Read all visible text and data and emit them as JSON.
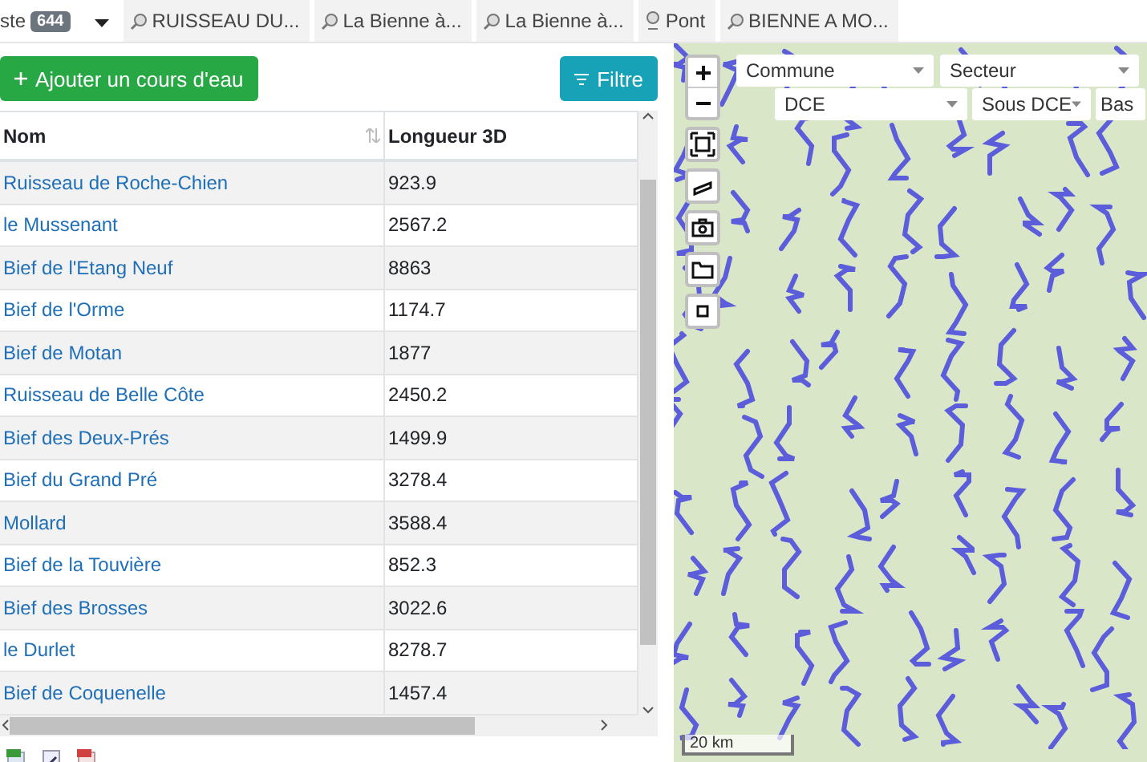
{
  "tabs": [
    {
      "label": "ste",
      "badge": "644",
      "kind": "list",
      "selected": true
    },
    {
      "label": "RUISSEAU DU...",
      "kind": "search",
      "selected": false
    },
    {
      "label": "La Bienne à...",
      "kind": "search",
      "selected": false
    },
    {
      "label": "La Bienne à...",
      "kind": "search",
      "selected": false
    },
    {
      "label": "Pont",
      "kind": "point",
      "selected": false
    },
    {
      "label": "BIENNE A MO...",
      "kind": "search",
      "selected": false
    }
  ],
  "toolbar": {
    "add_button": "Ajouter un cours d'eau",
    "filter_button": "Filtre"
  },
  "table": {
    "columns": [
      {
        "label": "Nom",
        "sortable": true
      },
      {
        "label": "Longueur 3D",
        "sortable": false
      }
    ],
    "rows": [
      {
        "name": "Ruisseau de Roche-Chien",
        "length": "923.9"
      },
      {
        "name": "le Mussenant",
        "length": "2567.2"
      },
      {
        "name": "Bief de l'Etang Neuf",
        "length": "8863"
      },
      {
        "name": "Bief de l'Orme",
        "length": "1174.7"
      },
      {
        "name": "Bief de Motan",
        "length": "1877"
      },
      {
        "name": "Ruisseau de Belle Côte",
        "length": "2450.2"
      },
      {
        "name": "Bief des Deux-Prés",
        "length": "1499.9"
      },
      {
        "name": "Bief du Grand Pré",
        "length": "3278.4"
      },
      {
        "name": "Mollard",
        "length": "3588.4"
      },
      {
        "name": "Bief de la Touvière",
        "length": "852.3"
      },
      {
        "name": "Bief des Brosses",
        "length": "3022.6"
      },
      {
        "name": "le Durlet",
        "length": "8278.7"
      },
      {
        "name": "Bief de Coquenelle",
        "length": "1457.4"
      }
    ]
  },
  "map": {
    "filters_row_1": [
      {
        "label": "Commune"
      },
      {
        "label": "Secteur"
      }
    ],
    "filters_row_2": [
      {
        "label": "DCE"
      },
      {
        "label": "Sous DCE"
      },
      {
        "label": "Bas"
      }
    ],
    "scale": "20 km"
  }
}
